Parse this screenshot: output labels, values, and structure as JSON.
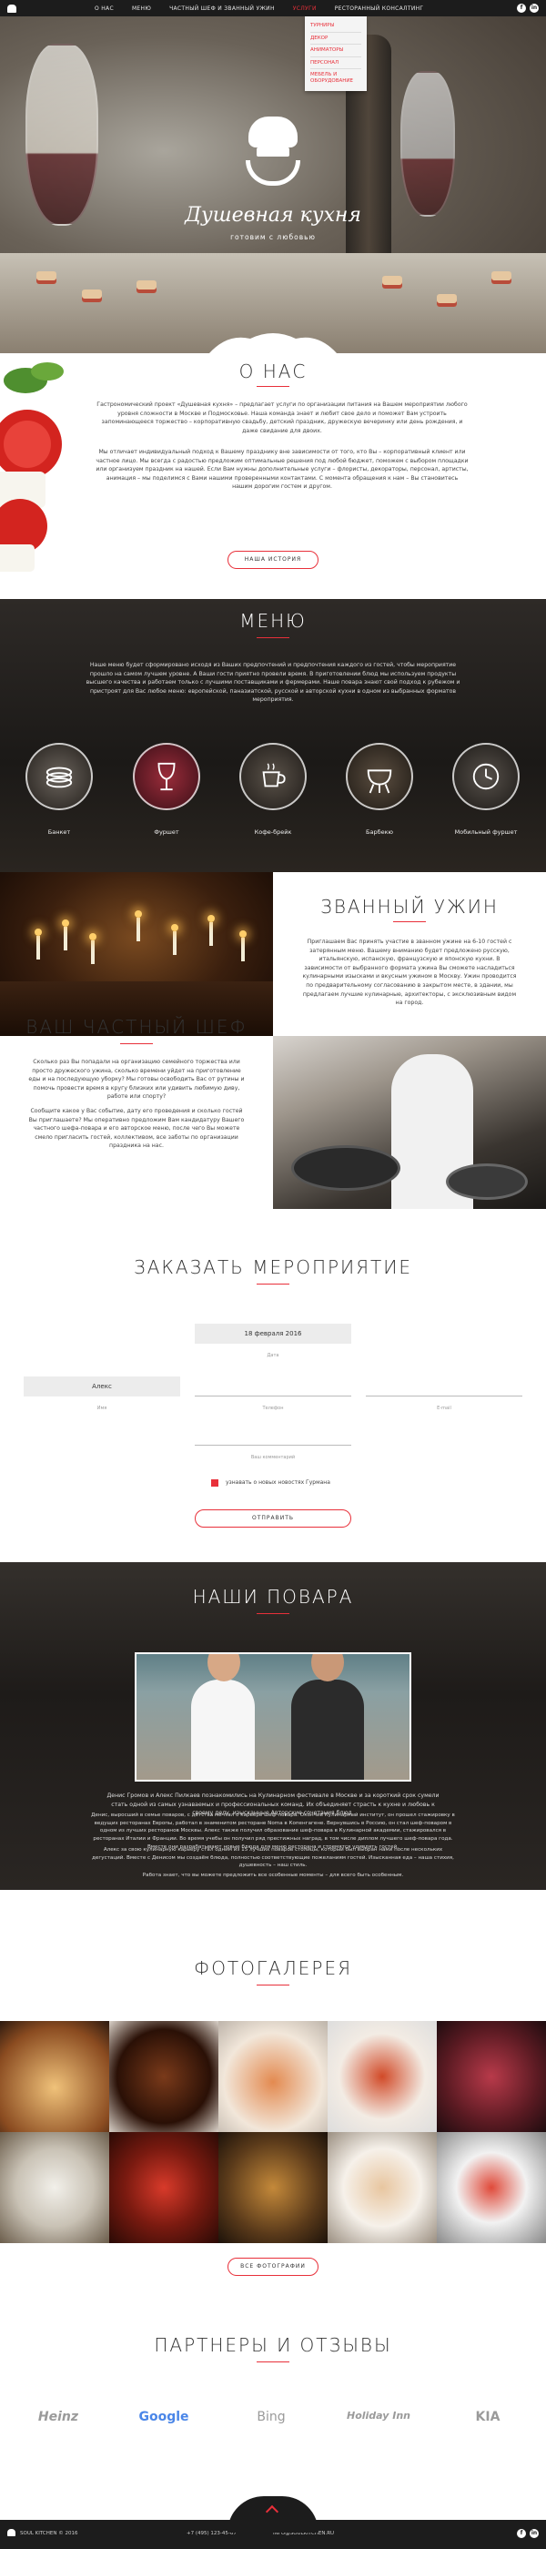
{
  "nav": {
    "items": [
      "О НАС",
      "МЕНЮ",
      "ЧАСТНЫЙ ШЕФ И ЗВАННЫЙ УЖИН",
      "УСЛУГИ",
      "РЕСТОРАННЫЙ КОНСАЛТИНГ"
    ],
    "active_index": 3,
    "social": [
      "f",
      "in"
    ]
  },
  "dropdown": [
    "ТУРНИРЫ",
    "ДЕКОР",
    "АНИМАТОРЫ",
    "ПЕРСОНАЛ",
    "МЕБЕЛЬ И ОБОРУДОВАНИЕ"
  ],
  "hero": {
    "brand": "Душевная кухня",
    "tagline": "готовим с любовью"
  },
  "about": {
    "title": "О НАС",
    "p1": "Гастрономический проект «Душевная кухня» – предлагает услуги по организации питания на Вашем мероприятии любого уровня сложности в Москве и Подмосковье. Наша команда знает и любит свое дело и поможет Вам устроить запоминающееся торжество – корпоративную свадьбу, детский праздник, дружескую вечеринку или день рождения, и даже свидание для двоих.",
    "p2": "Мы отличает индивидуальный подход к Вашему празднику вне зависимости от того, кто Вы – корпоративный клиент или частное лицо. Мы всегда с радостью предложим оптимальные решения под любой бюджет, поможем с выбором площадки или организуем праздник на нашей. Если Вам нужны дополнительные услуги – флористы, декораторы, персонал, артисты, анимация – мы поделимся с Вами нашими проверенными контактами. С момента обращения к нам – Вы становитесь нашим дорогим гостем и другом.",
    "button": "НАША ИСТОРИЯ"
  },
  "menu": {
    "title": "МЕНЮ",
    "text": "Наше меню будет сформировано исходя из Ваших предпочтений и предпочтения каждого из гостей, чтобы мероприятие прошло на самом лучшем уровне. А Ваши гости приятно провели время. В приготовлении блюд мы используем продукты высшего качества и работаем только с лучшими поставщиками и фермерами. Наше повара знают свой подход к рубежом и пристроят для Вас любое меню: европейской, паназиатской, русской и авторской кухни в одном из выбранных форматов мероприятия.",
    "categories": [
      "Банкет",
      "Фуршет",
      "Кофе-брейк",
      "Барбекю",
      "Мобильный фуршет"
    ]
  },
  "dinner": {
    "title": "ЗВАННЫЙ УЖИН",
    "text": "Приглашаем Вас принять участие в званном ужине на 6-10 гостей с затерянным меню. Вашему вниманию будет предложено русскую, итальянскую, испанскую, французскую и японскую кухни. В зависимости от выбранного формата ужина Вы сможете насладиться кулинарными изысками и вкусным ужином в Москву. Ужин проводится по предварительному согласованию в закрытом месте, в здании, мы предлагаем лучшие кулинарные, архитекторы, с эксклюзивным видом на город."
  },
  "chef": {
    "title": "ВАШ ЧАСТНЫЙ ШЕФ",
    "p1": "Сколько раз Вы попадали на организацию семейного торжества или просто дружеского ужина, сколько времени уйдет на приготовление еды и на последующую уборку? Мы готовы освободить Вас от рутины и помочь провести время в кругу близких или удивить любимую диву, работе или спорту?",
    "p2": "Сообщите какое у Вас событие, дату его проведения и сколько гостей Вы приглашаете? Мы оперативно предложим Вам кандидатуру Вашего частного шефа-повара и его авторское меню, после чего Вы можете смело пригласить гостей, коллективом, все заботы по организации праздника на нас."
  },
  "order": {
    "title": "ЗАКАЗАТЬ МЕРОПРИЯТИЕ",
    "date_value": "18 февраля 2016",
    "date_label": "Дата",
    "name_value": "Алекс",
    "name_label": "Имя",
    "phone_label": "Телефон",
    "email_label": "E-mail",
    "comment_label": "Ваш комментарий",
    "newsletter": "узнавать о новых новостях Гурмана",
    "submit": "ОТПРАВИТЬ"
  },
  "cooks": {
    "title": "НАШИ ПОВАРА",
    "p1": "Денис Громов и Алекс Пилкаев познакомились на Кулинарном фестивале в Москве и за короткий срок сумели стать одной из самых узнаваемых и профессиональных команд. Их объединяет страсть к кухне и любовь к своему делу, изысканные Авторские сочетания блюд.",
    "p2": "Денис, выросший в семье поваров, с детства мечтал о карьере шеф-повара. Окончив Кулинарный институт, он прошел стажировку в ведущих ресторанах Европы, работал в знаменитом ресторане Noma в Копенгагене. Вернувшись в Россию, он стал шеф-поваром в одном из лучших ресторанов Москвы. Алекс также получил образование шеф-повара в Кулинарной академии, стажировался в ресторанах Италии и Франции. Во время учебы он получил ряд престижных наград, в том числе диплом лучшего шеф-повара года. Вместе они разрабатывают новые блюда для меню ресторана и стремятся удивлять гостей.",
    "p3": "Алекс за свою кулинарную карьеру стал одним из 15 лучших поваров столицы, который был выбран нами после нескольких дегустаций. Вместе с Денисом мы создаём блюда, полностью соответствующие пожеланиям гостей. Изысканная еда – наша стихия, душевность – наш стиль.",
    "p4": "Работа знает, что вы можете предложить все особенные моменты – для всего быть особенным."
  },
  "gallery": {
    "title": "ФОТОГАЛЕРЕЯ",
    "button": "ВСЕ ФОТОГРАФИИ"
  },
  "partners": {
    "title": "ПАРТНЕРЫ И ОТЗЫВЫ",
    "logos": [
      "Heinz",
      "Google",
      "Bing",
      "Holiday Inn",
      "KIA"
    ]
  },
  "footer": {
    "copyright": "SOUL KITCHEN © 2016",
    "phone": "+7 (495) 123-45-67",
    "email": "INFO@SOULKITCHEN.RU"
  },
  "colors": {
    "accent": "#e8303a",
    "dark": "#1c1c1c"
  }
}
